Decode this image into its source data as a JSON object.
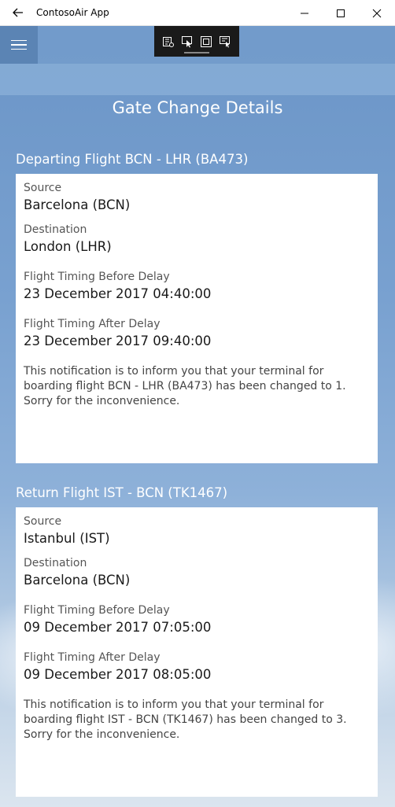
{
  "window": {
    "title": "ContosoAir App"
  },
  "page": {
    "title": "Gate Change Details"
  },
  "departing": {
    "heading": "Departing Flight BCN - LHR (BA473)",
    "source_label": "Source",
    "source_value": "Barcelona (BCN)",
    "destination_label": "Destination",
    "destination_value": "London (LHR)",
    "before_label": "Flight Timing Before Delay",
    "before_value": "23 December 2017 04:40:00",
    "after_label": "Flight Timing After Delay",
    "after_value": "23 December 2017 09:40:00",
    "notice_line1": "This notification is to inform you that your terminal for",
    "notice_line2": "boarding flight BCN - LHR (BA473) has been changed to 1.",
    "notice_line3": "Sorry for the inconvenience."
  },
  "returning": {
    "heading": "Return Flight IST - BCN (TK1467)",
    "source_label": "Source",
    "source_value": "Istanbul (IST)",
    "destination_label": "Destination",
    "destination_value": "Barcelona (BCN)",
    "before_label": "Flight Timing Before Delay",
    "before_value": "09 December 2017 07:05:00",
    "after_label": "Flight Timing After Delay",
    "after_value": "09 December 2017 08:05:00",
    "notice_line1": "This notification is to inform you that your terminal for",
    "notice_line2": "boarding flight IST - BCN (TK1467) has been changed to 3.",
    "notice_line3": "Sorry for the inconvenience."
  },
  "icons": {
    "back": "back-arrow-icon",
    "minimize": "minimize-icon",
    "maximize": "maximize-icon",
    "close": "close-icon",
    "menu": "hamburger-menu-icon"
  },
  "colors": {
    "background": "#6c95c6",
    "card": "#ffffff",
    "hamburger": "#5b84b4"
  }
}
